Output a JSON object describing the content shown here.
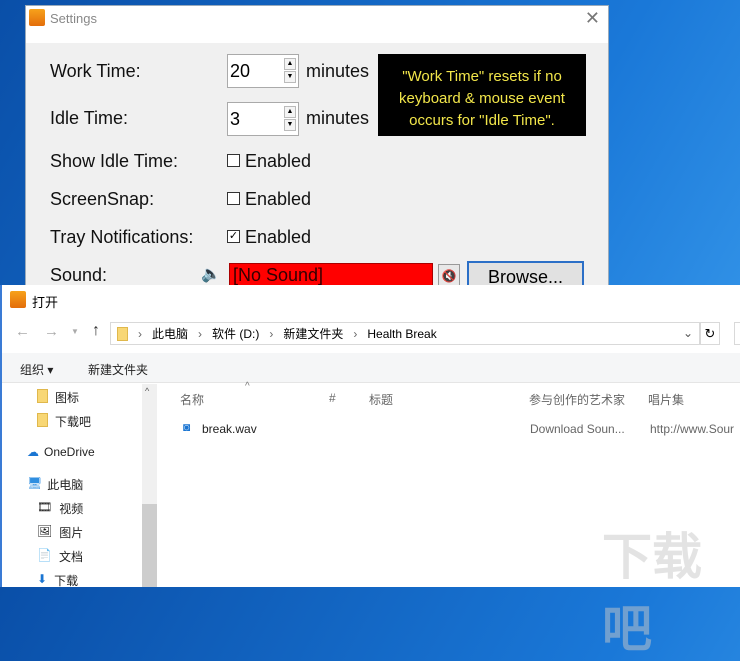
{
  "settings": {
    "title": "Settings",
    "close_icon": "close-icon",
    "work_time": {
      "label": "Work Time:",
      "value": "20",
      "unit": "minutes"
    },
    "idle_time": {
      "label": "Idle Time:",
      "value": "3",
      "unit": "minutes"
    },
    "show_idle_time": {
      "label": "Show Idle Time:",
      "option": "Enabled",
      "checked": false
    },
    "screensnap": {
      "label": "ScreenSnap:",
      "option": "Enabled",
      "checked": false
    },
    "tray_notifications": {
      "label": "Tray Notifications:",
      "option": "Enabled",
      "checked": true
    },
    "sound": {
      "label": "Sound:",
      "value": "[No Sound]",
      "value_bg": "#ff0000",
      "browse_label": "Browse..."
    },
    "tooltip": "\"Work Time\" resets if no keyboard & mouse event occurs for \"Idle Time\"."
  },
  "open_dialog": {
    "title": "打开",
    "breadcrumb": [
      "此电脑",
      "软件 (D:)",
      "新建文件夹",
      "Health Break"
    ],
    "toolbar": {
      "organize": "组织",
      "new_folder": "新建文件夹"
    },
    "nav_items": [
      {
        "label": "图标",
        "icon": "folder-icon"
      },
      {
        "label": "下载吧",
        "icon": "folder-icon"
      },
      {
        "label": "OneDrive",
        "icon": "cloud-icon"
      },
      {
        "label": "此电脑",
        "icon": "computer-icon"
      },
      {
        "label": "视频",
        "icon": "video-icon"
      },
      {
        "label": "图片",
        "icon": "picture-icon"
      },
      {
        "label": "文档",
        "icon": "document-icon"
      },
      {
        "label": "下载",
        "icon": "download-icon"
      }
    ],
    "columns": [
      "名称",
      "#",
      "标题",
      "参与创作的艺术家",
      "唱片集"
    ],
    "files": [
      {
        "name": "break.wav",
        "artist": "Download Soun...",
        "album": "http://www.Sour"
      }
    ]
  },
  "watermark": "下载吧 www.xiazaiba.com"
}
